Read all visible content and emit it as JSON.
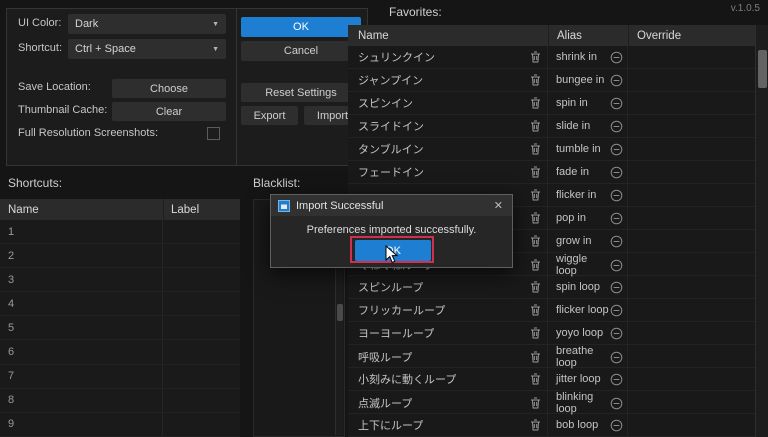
{
  "version": "v.1.0.5",
  "colors": {
    "accent_blue": "#1e7ed2",
    "annotation_red": "#ce3150"
  },
  "icons": {
    "chevron_down": "▼",
    "close": "✕"
  },
  "settings_panel": {
    "ui_color": {
      "label": "UI Color:",
      "value": "Dark"
    },
    "shortcut": {
      "label": "Shortcut:",
      "value": "Ctrl + Space"
    },
    "save_location": {
      "label": "Save Location:",
      "button": "Choose"
    },
    "thumbnail_cache": {
      "label": "Thumbnail Cache:",
      "button": "Clear"
    },
    "full_resolution": {
      "label": "Full Resolution Screenshots:"
    },
    "buttons": {
      "ok": "OK",
      "cancel": "Cancel",
      "reset": "Reset Settings",
      "export": "Export",
      "import": "Import"
    }
  },
  "shortcuts": {
    "label": "Shortcuts:",
    "columns": {
      "name": "Name",
      "label": "Label"
    },
    "row_numbers": [
      "1",
      "2",
      "3",
      "4",
      "5",
      "6",
      "7",
      "8",
      "9"
    ]
  },
  "blacklist": {
    "label": "Blacklist:"
  },
  "favorites": {
    "label": "Favorites:",
    "columns": {
      "name": "Name",
      "alias": "Alias",
      "override": "Override"
    },
    "items": [
      {
        "name": "シュリンクイン",
        "alias": "shrink in"
      },
      {
        "name": "ジャンプイン",
        "alias": "bungee in"
      },
      {
        "name": "スピンイン",
        "alias": "spin in"
      },
      {
        "name": "スライドイン",
        "alias": "slide in"
      },
      {
        "name": "タンブルイン",
        "alias": "tumble in"
      },
      {
        "name": "フェードイン",
        "alias": "fade in"
      },
      {
        "name": "",
        "alias": "flicker in"
      },
      {
        "name": "",
        "alias": "pop in"
      },
      {
        "name": "",
        "alias": "grow in"
      },
      {
        "name": "くねくねループ",
        "alias": "wiggle loop"
      },
      {
        "name": "スピンループ",
        "alias": "spin loop"
      },
      {
        "name": "フリッカーループ",
        "alias": "flicker loop"
      },
      {
        "name": "ヨーヨーループ",
        "alias": "yoyo loop"
      },
      {
        "name": "呼吸ループ",
        "alias": "breathe loop"
      },
      {
        "name": "小刻みに動くループ",
        "alias": "jitter loop"
      },
      {
        "name": "点滅ループ",
        "alias": "blinking loop"
      },
      {
        "name": "上下にループ",
        "alias": "bob loop"
      }
    ]
  },
  "dialog": {
    "title": "Import Successful",
    "message": "Preferences imported successfully.",
    "ok": "OK"
  }
}
